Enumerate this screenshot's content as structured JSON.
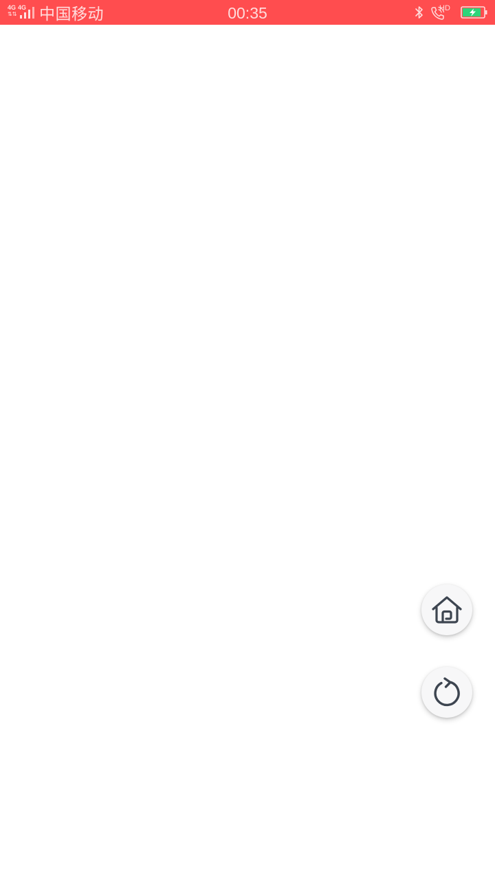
{
  "status_bar": {
    "network_type_1": "4G",
    "network_type_2": "4G",
    "carrier": "中国移动",
    "time": "00:35",
    "hd_label": "HD",
    "background_color": "#ff4d4f",
    "icons": [
      "signal-icon",
      "bluetooth-icon",
      "hd-call-icon",
      "battery-charging-icon"
    ]
  },
  "floating_buttons": {
    "home_icon": "home-icon",
    "refresh_icon": "refresh-icon"
  }
}
